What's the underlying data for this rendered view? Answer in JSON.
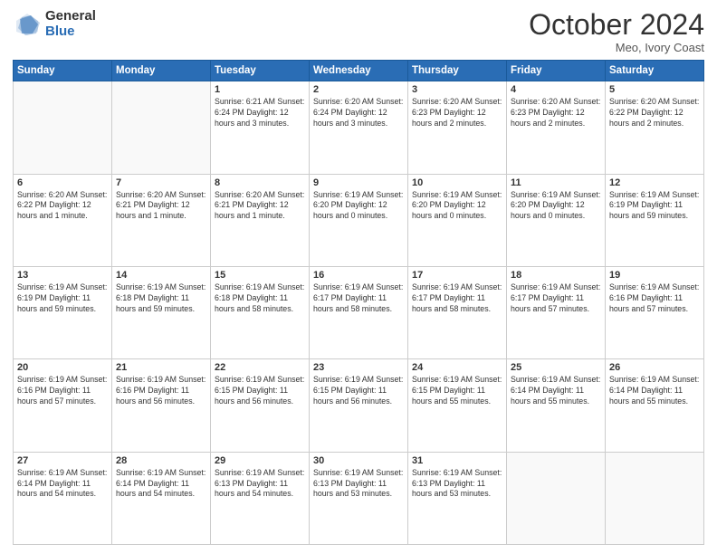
{
  "header": {
    "logo_general": "General",
    "logo_blue": "Blue",
    "month_title": "October 2024",
    "location": "Meo, Ivory Coast"
  },
  "days_of_week": [
    "Sunday",
    "Monday",
    "Tuesday",
    "Wednesday",
    "Thursday",
    "Friday",
    "Saturday"
  ],
  "weeks": [
    [
      {
        "day": "",
        "info": ""
      },
      {
        "day": "",
        "info": ""
      },
      {
        "day": "1",
        "info": "Sunrise: 6:21 AM\nSunset: 6:24 PM\nDaylight: 12 hours and 3 minutes."
      },
      {
        "day": "2",
        "info": "Sunrise: 6:20 AM\nSunset: 6:24 PM\nDaylight: 12 hours and 3 minutes."
      },
      {
        "day": "3",
        "info": "Sunrise: 6:20 AM\nSunset: 6:23 PM\nDaylight: 12 hours and 2 minutes."
      },
      {
        "day": "4",
        "info": "Sunrise: 6:20 AM\nSunset: 6:23 PM\nDaylight: 12 hours and 2 minutes."
      },
      {
        "day": "5",
        "info": "Sunrise: 6:20 AM\nSunset: 6:22 PM\nDaylight: 12 hours and 2 minutes."
      }
    ],
    [
      {
        "day": "6",
        "info": "Sunrise: 6:20 AM\nSunset: 6:22 PM\nDaylight: 12 hours and 1 minute."
      },
      {
        "day": "7",
        "info": "Sunrise: 6:20 AM\nSunset: 6:21 PM\nDaylight: 12 hours and 1 minute."
      },
      {
        "day": "8",
        "info": "Sunrise: 6:20 AM\nSunset: 6:21 PM\nDaylight: 12 hours and 1 minute."
      },
      {
        "day": "9",
        "info": "Sunrise: 6:19 AM\nSunset: 6:20 PM\nDaylight: 12 hours and 0 minutes."
      },
      {
        "day": "10",
        "info": "Sunrise: 6:19 AM\nSunset: 6:20 PM\nDaylight: 12 hours and 0 minutes."
      },
      {
        "day": "11",
        "info": "Sunrise: 6:19 AM\nSunset: 6:20 PM\nDaylight: 12 hours and 0 minutes."
      },
      {
        "day": "12",
        "info": "Sunrise: 6:19 AM\nSunset: 6:19 PM\nDaylight: 11 hours and 59 minutes."
      }
    ],
    [
      {
        "day": "13",
        "info": "Sunrise: 6:19 AM\nSunset: 6:19 PM\nDaylight: 11 hours and 59 minutes."
      },
      {
        "day": "14",
        "info": "Sunrise: 6:19 AM\nSunset: 6:18 PM\nDaylight: 11 hours and 59 minutes."
      },
      {
        "day": "15",
        "info": "Sunrise: 6:19 AM\nSunset: 6:18 PM\nDaylight: 11 hours and 58 minutes."
      },
      {
        "day": "16",
        "info": "Sunrise: 6:19 AM\nSunset: 6:17 PM\nDaylight: 11 hours and 58 minutes."
      },
      {
        "day": "17",
        "info": "Sunrise: 6:19 AM\nSunset: 6:17 PM\nDaylight: 11 hours and 58 minutes."
      },
      {
        "day": "18",
        "info": "Sunrise: 6:19 AM\nSunset: 6:17 PM\nDaylight: 11 hours and 57 minutes."
      },
      {
        "day": "19",
        "info": "Sunrise: 6:19 AM\nSunset: 6:16 PM\nDaylight: 11 hours and 57 minutes."
      }
    ],
    [
      {
        "day": "20",
        "info": "Sunrise: 6:19 AM\nSunset: 6:16 PM\nDaylight: 11 hours and 57 minutes."
      },
      {
        "day": "21",
        "info": "Sunrise: 6:19 AM\nSunset: 6:16 PM\nDaylight: 11 hours and 56 minutes."
      },
      {
        "day": "22",
        "info": "Sunrise: 6:19 AM\nSunset: 6:15 PM\nDaylight: 11 hours and 56 minutes."
      },
      {
        "day": "23",
        "info": "Sunrise: 6:19 AM\nSunset: 6:15 PM\nDaylight: 11 hours and 56 minutes."
      },
      {
        "day": "24",
        "info": "Sunrise: 6:19 AM\nSunset: 6:15 PM\nDaylight: 11 hours and 55 minutes."
      },
      {
        "day": "25",
        "info": "Sunrise: 6:19 AM\nSunset: 6:14 PM\nDaylight: 11 hours and 55 minutes."
      },
      {
        "day": "26",
        "info": "Sunrise: 6:19 AM\nSunset: 6:14 PM\nDaylight: 11 hours and 55 minutes."
      }
    ],
    [
      {
        "day": "27",
        "info": "Sunrise: 6:19 AM\nSunset: 6:14 PM\nDaylight: 11 hours and 54 minutes."
      },
      {
        "day": "28",
        "info": "Sunrise: 6:19 AM\nSunset: 6:14 PM\nDaylight: 11 hours and 54 minutes."
      },
      {
        "day": "29",
        "info": "Sunrise: 6:19 AM\nSunset: 6:13 PM\nDaylight: 11 hours and 54 minutes."
      },
      {
        "day": "30",
        "info": "Sunrise: 6:19 AM\nSunset: 6:13 PM\nDaylight: 11 hours and 53 minutes."
      },
      {
        "day": "31",
        "info": "Sunrise: 6:19 AM\nSunset: 6:13 PM\nDaylight: 11 hours and 53 minutes."
      },
      {
        "day": "",
        "info": ""
      },
      {
        "day": "",
        "info": ""
      }
    ]
  ]
}
